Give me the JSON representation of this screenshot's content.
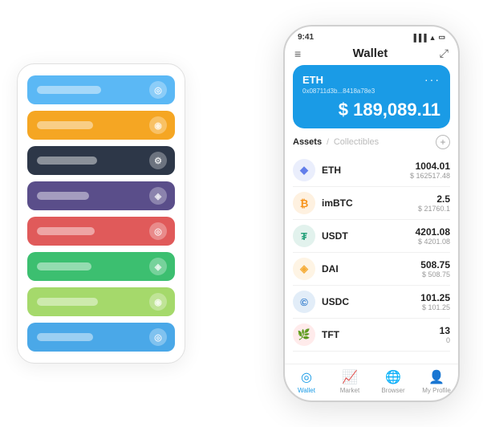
{
  "left_cards": [
    {
      "color": "#5bb8f5",
      "label_width": "80px",
      "icon": "◎"
    },
    {
      "color": "#f5a623",
      "label_width": "70px",
      "icon": "◉"
    },
    {
      "color": "#2d3748",
      "label_width": "75px",
      "icon": "⚙"
    },
    {
      "color": "#5a4e8a",
      "label_width": "65px",
      "icon": "◈"
    },
    {
      "color": "#e05a5a",
      "label_width": "72px",
      "icon": "◎"
    },
    {
      "color": "#3cbf70",
      "label_width": "68px",
      "icon": "◈"
    },
    {
      "color": "#a5d96b",
      "label_width": "76px",
      "icon": "◉"
    },
    {
      "color": "#4aa8e8",
      "label_width": "70px",
      "icon": "◎"
    }
  ],
  "phone": {
    "status_time": "9:41",
    "title": "Wallet",
    "eth_card": {
      "name": "ETH",
      "address": "0x08711d3b...8418a78e3",
      "balance": "$ 189,089.11",
      "dollar_sign": "$"
    },
    "assets_tab": "Assets",
    "collectibles_tab": "Collectibles",
    "add_btn": "+",
    "assets": [
      {
        "symbol": "ETH",
        "icon": "◆",
        "icon_class": "icon-eth",
        "amount": "1004.01",
        "usd": "$ 162517.48"
      },
      {
        "symbol": "imBTC",
        "icon": "₿",
        "icon_class": "icon-imbtc",
        "amount": "2.5",
        "usd": "$ 21760.1"
      },
      {
        "symbol": "USDT",
        "icon": "₮",
        "icon_class": "icon-usdt",
        "amount": "4201.08",
        "usd": "$ 4201.08"
      },
      {
        "symbol": "DAI",
        "icon": "◈",
        "icon_class": "icon-dai",
        "amount": "508.75",
        "usd": "$ 508.75"
      },
      {
        "symbol": "USDC",
        "icon": "©",
        "icon_class": "icon-usdc",
        "amount": "101.25",
        "usd": "$ 101.25"
      },
      {
        "symbol": "TFT",
        "icon": "🌿",
        "icon_class": "icon-tft",
        "amount": "13",
        "usd": "0"
      }
    ],
    "nav": [
      {
        "label": "Wallet",
        "icon": "◎",
        "active": true
      },
      {
        "label": "Market",
        "icon": "📊",
        "active": false
      },
      {
        "label": "Browser",
        "icon": "👤",
        "active": false
      },
      {
        "label": "My Profile",
        "icon": "👤",
        "active": false
      }
    ]
  }
}
